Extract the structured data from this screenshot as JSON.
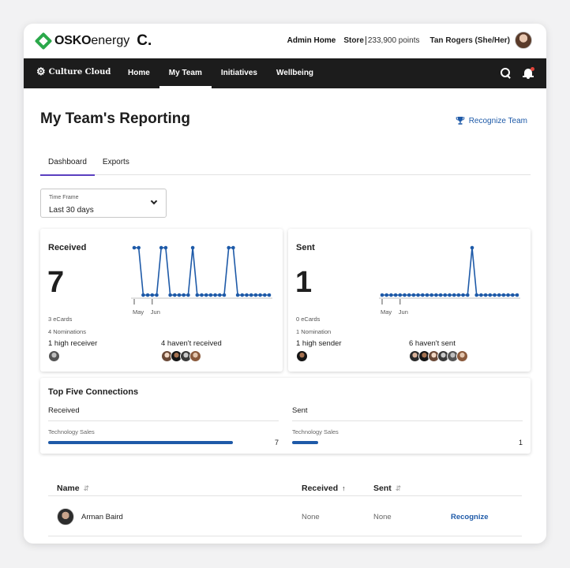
{
  "header": {
    "logo_osko": "OSKO",
    "logo_energy": "energy",
    "logo_c": "C.",
    "admin_home": "Admin Home",
    "store_label": "Store",
    "points": "233,900 points",
    "user_name": "Tan Rogers (She/Her)"
  },
  "nav": {
    "brand": "Culture Cloud",
    "items": [
      {
        "label": "Home",
        "active": false
      },
      {
        "label": "My Team",
        "active": true
      },
      {
        "label": "Initiatives",
        "active": false
      },
      {
        "label": "Wellbeing",
        "active": false
      }
    ]
  },
  "page": {
    "title": "My Team's Reporting",
    "recognize_team": "Recognize Team",
    "tabs": [
      {
        "label": "Dashboard",
        "active": true
      },
      {
        "label": "Exports",
        "active": false
      }
    ],
    "timeframe": {
      "label": "Time Frame",
      "value": "Last 30 days"
    }
  },
  "received": {
    "title": "Received",
    "total": "7",
    "ecards": "3 eCards",
    "nominations": "4 Nominations",
    "high": "1 high receiver",
    "havent": "4 haven't received",
    "month_labels": [
      "May",
      "Jun"
    ],
    "daily_values": [
      1,
      1,
      0,
      0,
      0,
      0,
      1,
      1,
      0,
      0,
      0,
      0,
      0,
      1,
      0,
      0,
      0,
      0,
      0,
      0,
      0,
      1,
      1,
      0,
      0,
      0,
      0,
      0,
      0,
      0,
      0
    ]
  },
  "sent": {
    "title": "Sent",
    "total": "1",
    "ecards": "0 eCards",
    "nominations": "1 Nomination",
    "high": "1 high sender",
    "havent": "6 haven't sent",
    "month_labels": [
      "May",
      "Jun"
    ],
    "daily_values": [
      0,
      0,
      0,
      0,
      0,
      0,
      0,
      0,
      0,
      0,
      0,
      0,
      0,
      0,
      0,
      0,
      0,
      0,
      0,
      0,
      1,
      0,
      0,
      0,
      0,
      0,
      0,
      0,
      0,
      0,
      0
    ]
  },
  "connections": {
    "title": "Top Five Connections",
    "received": {
      "header": "Received",
      "team": "Technology Sales",
      "value": "7",
      "fraction": 1.0
    },
    "sent": {
      "header": "Sent",
      "team": "Technology Sales",
      "value": "1",
      "fraction": 0.14
    }
  },
  "table": {
    "columns": {
      "name": "Name",
      "received": "Received",
      "sent": "Sent"
    },
    "sort_icon": "⇵",
    "sort_up": "↑",
    "rows": [
      {
        "name": "Arman Baird",
        "received": "None",
        "sent": "None",
        "action": "Recognize"
      }
    ]
  },
  "colors": {
    "accent_blue": "#1e5aa8",
    "nav_bg": "#1c1c1c",
    "tab_underline": "#5a3fc0",
    "brand_green": "#2aa84a",
    "notification": "#e0443a"
  },
  "icons": [
    "osko-diamond-icon",
    "cloud-gear-icon",
    "search-icon",
    "bell-icon",
    "trophy-icon",
    "chevron-down-icon",
    "sort-icon",
    "sort-up-icon"
  ]
}
